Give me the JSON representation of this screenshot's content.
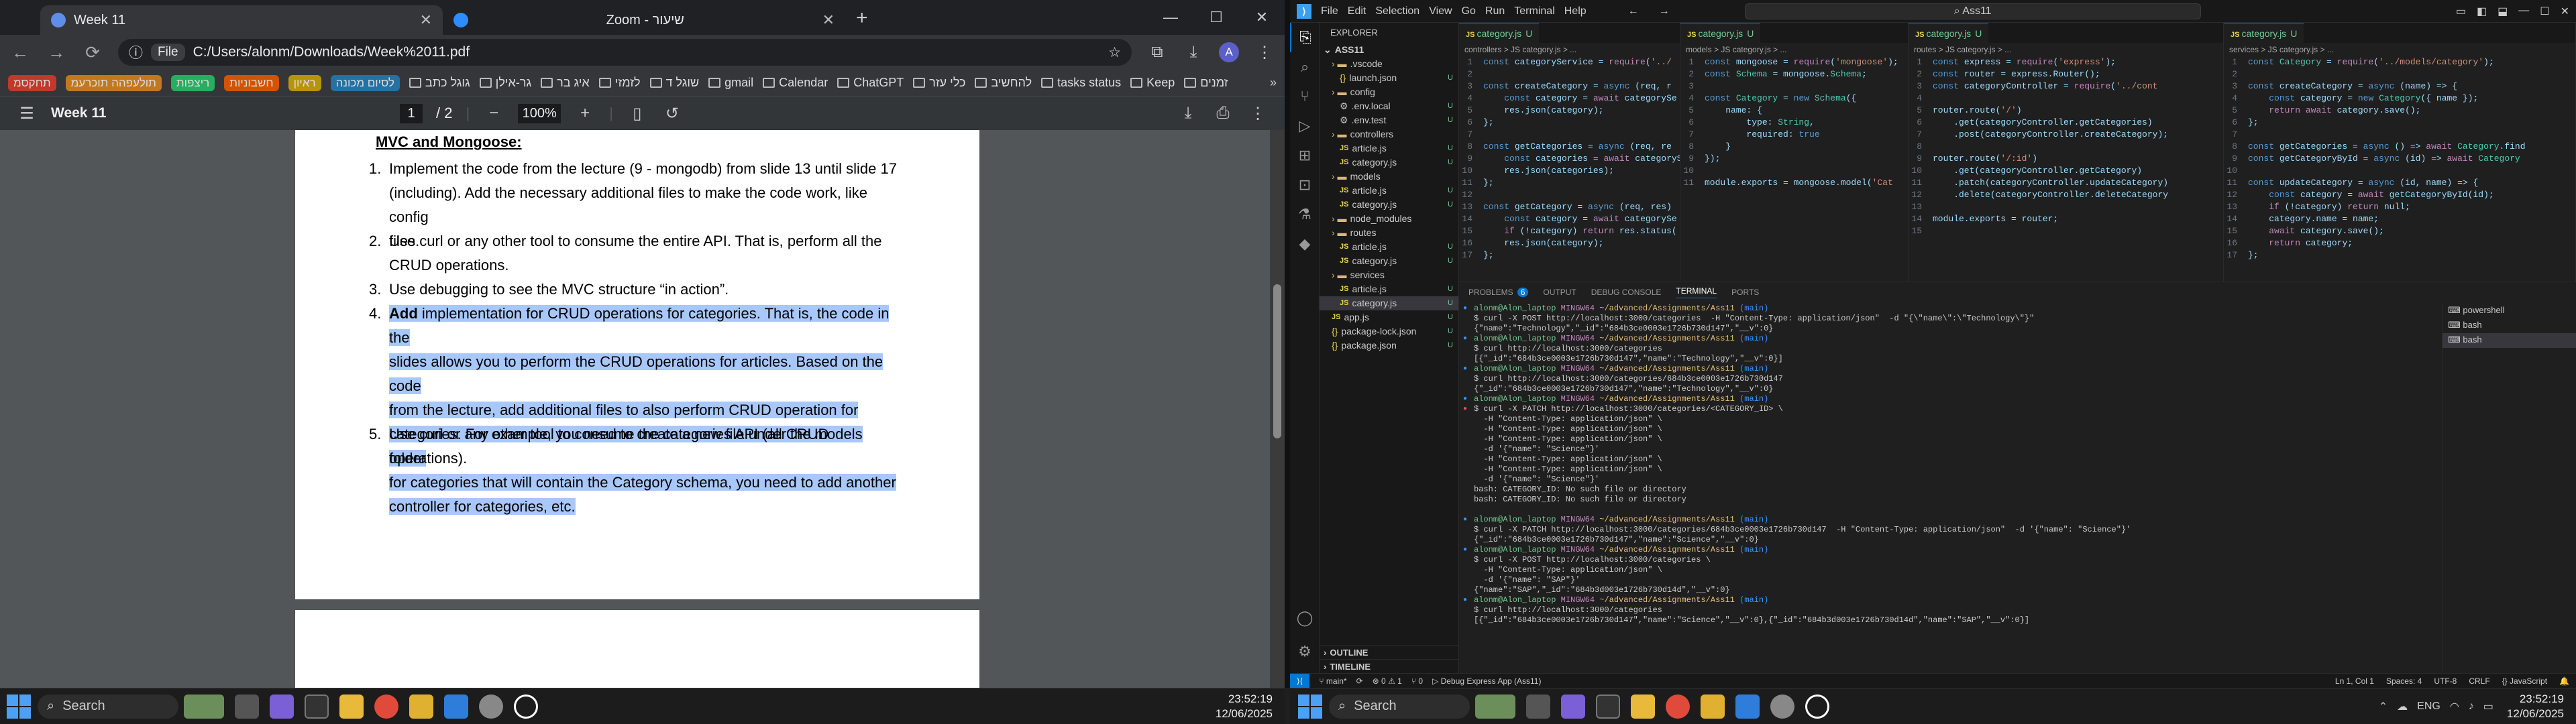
{
  "browser": {
    "tabs": [
      {
        "label": "Week 11",
        "active": true
      },
      {
        "label": "Zoom - שיעור",
        "active": false
      }
    ],
    "address": {
      "chip": "File",
      "url": "C:/Users/alonm/Downloads/Week%2011.pdf"
    },
    "avatar_letter": "A",
    "bookmarks": [
      "תחקסמ",
      "תולעפהה תוכרעמ",
      "ריצפות",
      "חשבוניות",
      "ראיון",
      "לסיום מכונה",
      "גוגל כתב",
      "גר-אילן",
      "איג בר",
      "לזמזי",
      "שוגל ד",
      "gmail",
      "Calendar",
      "ChatGPT",
      "כלי עזר",
      "להחשיב",
      "tasks status",
      "Keep",
      "זמנים"
    ]
  },
  "pdf": {
    "title": "Week 11",
    "page_current": "1",
    "page_total": "/ 2",
    "zoom": "100%",
    "heading": "MVC and Mongoose:",
    "items": [
      {
        "num": "1.",
        "lines": [
          "Implement the code from the lecture (9 - mongodb) from slide 13 until slide 17",
          "(including). Add the necessary additional files to make the code work, like config",
          "files."
        ]
      },
      {
        "num": "2.",
        "lines": [
          "Use curl or any other tool to consume the entire API. That is, perform all the",
          "CRUD operations."
        ]
      },
      {
        "num": "3.",
        "lines": [
          "Use debugging to see the MVC structure “in action”."
        ]
      },
      {
        "num": "4.",
        "bold": "Add",
        "lines": [
          " implementation for CRUD operations for categories. That is, the code in the",
          "slides allows you to perform the CRUD operations for articles. Based on the code",
          "from the lecture, add additional files to also perform CRUD operation for",
          "categories. For example, you need to create a new file under the models folder",
          "for categories that will contain the Category schema, you need to add another",
          "controller for categories, etc."
        ]
      },
      {
        "num": "5.",
        "lines": [
          "Use curl or any other tool to consume the categories API (all CRUD operations)."
        ]
      }
    ]
  },
  "vscode": {
    "menu": [
      "File",
      "Edit",
      "Selection",
      "View",
      "Go",
      "Run",
      "Terminal",
      "Help"
    ],
    "search": "Ass11",
    "explorer_title": "EXPLORER",
    "root": "ASS11",
    "tree": [
      {
        "name": ".vscode",
        "type": "folder",
        "depth": 1
      },
      {
        "name": "launch.json",
        "type": "json",
        "depth": 2
      },
      {
        "name": "config",
        "type": "folder",
        "depth": 1
      },
      {
        "name": ".env.local",
        "type": "env",
        "depth": 2
      },
      {
        "name": ".env.test",
        "type": "env",
        "depth": 2
      },
      {
        "name": "controllers",
        "type": "folder",
        "depth": 1
      },
      {
        "name": "article.js",
        "type": "js",
        "depth": 2
      },
      {
        "name": "category.js",
        "type": "js",
        "depth": 2
      },
      {
        "name": "models",
        "type": "folder",
        "depth": 1
      },
      {
        "name": "article.js",
        "type": "js",
        "depth": 2
      },
      {
        "name": "category.js",
        "type": "js",
        "depth": 2
      },
      {
        "name": "node_modules",
        "type": "folder",
        "depth": 1
      },
      {
        "name": "routes",
        "type": "folder",
        "depth": 1
      },
      {
        "name": "article.js",
        "type": "js",
        "depth": 2
      },
      {
        "name": "category.js",
        "type": "js",
        "depth": 2
      },
      {
        "name": "services",
        "type": "folder",
        "depth": 1
      },
      {
        "name": "article.js",
        "type": "js",
        "depth": 2
      },
      {
        "name": "category.js",
        "type": "js",
        "depth": 2,
        "selected": true
      },
      {
        "name": "app.js",
        "type": "js",
        "depth": 1
      },
      {
        "name": "package-lock.json",
        "type": "json",
        "depth": 1
      },
      {
        "name": "package.json",
        "type": "json",
        "depth": 1
      }
    ],
    "outline": "OUTLINE",
    "timeline": "TIMELINE",
    "editors": [
      {
        "tab": "category.js",
        "crumb": "controllers > JS category.js > ...",
        "lines": [
          "const categoryService = require('../",
          "",
          "const createCategory = async (req, r",
          "    const category = await categorySe",
          "    res.json(category);",
          "};",
          "",
          "const getCategories = async (req, re",
          "    const categories = await categoryS",
          "    res.json(categories);",
          "};",
          "",
          "const getCategory = async (req, res)",
          "    const category = await categorySe",
          "    if (!category) return res.status(",
          "    res.json(category);",
          "};"
        ]
      },
      {
        "tab": "category.js",
        "crumb": "models > JS category.js > ...",
        "lines": [
          "const mongoose = require('mongoose');",
          "const Schema = mongoose.Schema;",
          "",
          "const Category = new Schema({",
          "    name: {",
          "        type: String,",
          "        required: true",
          "    }",
          "});",
          "",
          "module.exports = mongoose.model('Cat"
        ]
      },
      {
        "tab": "category.js",
        "crumb": "routes > JS category.js > ...",
        "lines": [
          "const express = require('express');",
          "const router = express.Router();",
          "const categoryController = require('../cont",
          "",
          "router.route('/')",
          "    .get(categoryController.getCategories)",
          "    .post(categoryController.createCategory);",
          "",
          "router.route('/:id')",
          "    .get(categoryController.getCategory)",
          "    .patch(categoryController.updateCategory)",
          "    .delete(categoryController.deleteCategory",
          "",
          "module.exports = router;",
          ""
        ]
      },
      {
        "tab": "category.js",
        "crumb": "services > JS category.js > ...",
        "lines": [
          "const Category = require('../models/category');",
          "",
          "const createCategory = async (name) => {",
          "    const category = new Category({ name });",
          "    return await category.save();",
          "};",
          "",
          "const getCategories = async () => await Category.find",
          "const getCategoryById = async (id) => await Category",
          "",
          "const updateCategory = async (id, name) => {",
          "    const category = await getCategoryById(id);",
          "    if (!category) return null;",
          "    category.name = name;",
          "    await category.save();",
          "    return category;",
          "};"
        ]
      }
    ],
    "panel_tabs": [
      "PROBLEMS",
      "OUTPUT",
      "DEBUG CONSOLE",
      "TERMINAL",
      "PORTS"
    ],
    "problems_count": "6",
    "terminal": [
      {
        "t": "p"
      },
      {
        "t": "c",
        "text": "$ curl -X POST http://localhost:3000/categories  -H \"Content-Type: application/json\"  -d \"{\\\"name\\\":\\\"Technology\\\"}\""
      },
      {
        "t": "o",
        "text": "{\"name\":\"Technology\",\"_id\":\"684b3ce0003e1726b730d147\",\"__v\":0}"
      },
      {
        "t": "p"
      },
      {
        "t": "c",
        "text": "$ curl http://localhost:3000/categories"
      },
      {
        "t": "o",
        "text": "[{\"_id\":\"684b3ce0003e1726b730d147\",\"name\":\"Technology\",\"__v\":0}]"
      },
      {
        "t": "p"
      },
      {
        "t": "c",
        "text": "$ curl http://localhost:3000/categories/684b3ce0003e1726b730d147"
      },
      {
        "t": "o",
        "text": "{\"_id\":\"684b3ce0003e1726b730d147\",\"name\":\"Technology\",\"__v\":0}"
      },
      {
        "t": "p"
      },
      {
        "t": "e",
        "text": "$ curl -X PATCH http://localhost:3000/categories/<CATEGORY_ID> \\"
      },
      {
        "t": "o",
        "text": "  -H \"Content-Type: application/json\" \\"
      },
      {
        "t": "o",
        "text": "  -H \"Content-Type: application/json\" \\"
      },
      {
        "t": "o",
        "text": "  -H \"Content-Type: application/json\" \\"
      },
      {
        "t": "o",
        "text": "  -d '{\"name\": \"Science\"}'"
      },
      {
        "t": "o",
        "text": "  -H \"Content-Type: application/json\" \\"
      },
      {
        "t": "o",
        "text": "  -H \"Content-Type: application/json\" \\"
      },
      {
        "t": "o",
        "text": "  -d '{\"name\": \"Science\"}'"
      },
      {
        "t": "o",
        "text": "bash: CATEGORY_ID: No such file or directory"
      },
      {
        "t": "o",
        "text": "bash: CATEGORY_ID: No such file or directory"
      },
      {
        "t": "o",
        "text": ""
      },
      {
        "t": "p"
      },
      {
        "t": "c",
        "text": "$ curl -X PATCH http://localhost:3000/categories/684b3ce0003e1726b730d147  -H \"Content-Type: application/json\"  -d '{\"name\": \"Science\"}'"
      },
      {
        "t": "o",
        "text": "{\"_id\":\"684b3ce0003e1726b730d147\",\"name\":\"Science\",\"__v\":0}"
      },
      {
        "t": "p"
      },
      {
        "t": "c",
        "text": "$ curl -X POST http://localhost:3000/categories \\"
      },
      {
        "t": "o",
        "text": "  -H \"Content-Type: application/json\" \\"
      },
      {
        "t": "o",
        "text": "  -d '{\"name\": \"SAP\"}'"
      },
      {
        "t": "o",
        "text": "{\"name\":\"SAP\",\"_id\":\"684b3d003e1726b730d14d\",\"__v\":0}"
      },
      {
        "t": "p"
      },
      {
        "t": "c",
        "text": "$ curl http://localhost:3000/categories"
      },
      {
        "t": "o",
        "text": "[{\"_id\":\"684b3ce0003e1726b730d147\",\"name\":\"Science\",\"__v\":0},{\"_id\":\"684b3d003e1726b730d14d\",\"name\":\"SAP\",\"__v\":0}]"
      }
    ],
    "prompt": {
      "user": "alonm@Alon_laptop",
      "env": "MINGW64",
      "path": "~/advanced/Assignments/Ass11",
      "branch": "(main)"
    },
    "shells": [
      "powershell",
      "bash",
      "bash"
    ],
    "status": {
      "branch": "main*",
      "sync": "⟳",
      "errors": "⊗ 0 ⚠ 1",
      "ports": "⑂ 0",
      "debug": "Debug Express App (Ass11)",
      "right": [
        "Ln 1, Col 1",
        "Spaces: 4",
        "UTF-8",
        "CRLF",
        "{} JavaScript"
      ]
    }
  },
  "taskbar": {
    "search": "Search",
    "time": "23:52:19",
    "date": "12/06/2025",
    "lang": "ENG"
  }
}
